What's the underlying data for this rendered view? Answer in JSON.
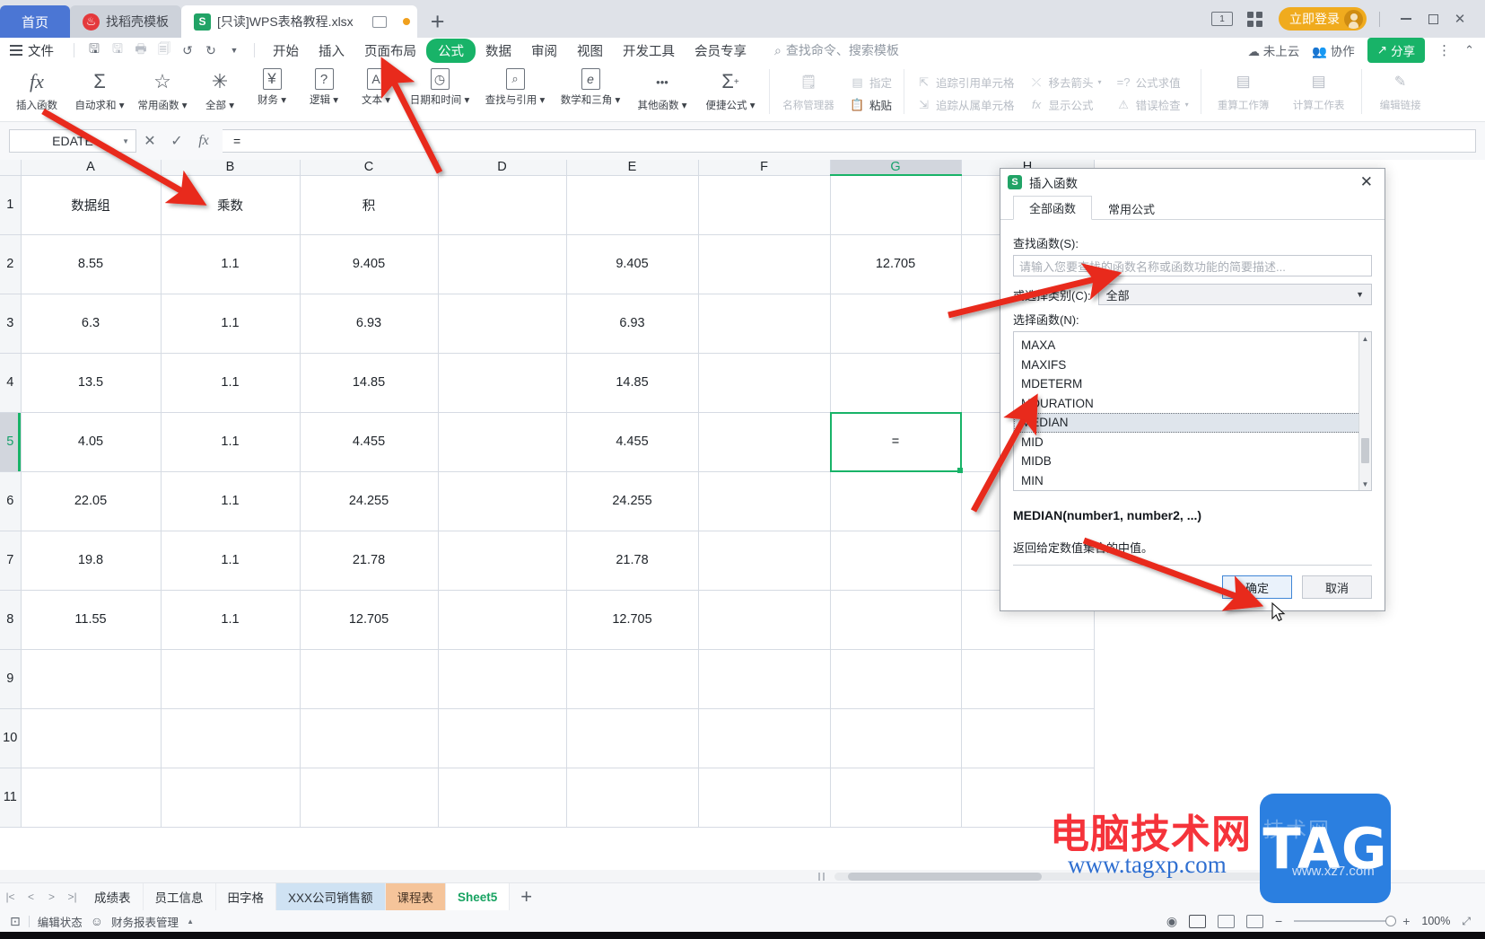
{
  "window": {
    "tabs": [
      {
        "label": "首页",
        "kind": "home"
      },
      {
        "label": "找稻壳模板",
        "kind": "template",
        "icon": "wps-dove-icon"
      },
      {
        "label": "[只读]WPS表格教程.xlsx",
        "kind": "doc",
        "icon": "spreadsheet-icon"
      }
    ],
    "new_tab": "+",
    "screens_badge": "1",
    "login_label": "立即登录",
    "minimize": "–",
    "maximize": "□",
    "close": "✕"
  },
  "menu": {
    "file_label": "文件",
    "quick_icons": [
      "save-icon",
      "save-as-icon",
      "print-icon",
      "print-preview-icon",
      "undo-icon",
      "redo-icon",
      "customize-icon"
    ],
    "items": [
      "开始",
      "插入",
      "页面布局",
      "公式",
      "数据",
      "审阅",
      "视图",
      "开发工具",
      "会员专享"
    ],
    "active_item": "公式",
    "search_placeholder": "查找命令、搜索模板",
    "cloud_status": "未上云",
    "collaborate": "协作",
    "share": "分享"
  },
  "ribbon": {
    "big_buttons": [
      {
        "label": "插入函数",
        "glyph": "fx",
        "caret": false
      },
      {
        "label": "自动求和",
        "glyph": "Σ",
        "caret": true
      },
      {
        "label": "常用函数",
        "glyph": "☆",
        "caret": true
      },
      {
        "label": "全部",
        "glyph": "✳",
        "caret": true
      },
      {
        "label": "财务",
        "glyph": "¥",
        "caret": true
      },
      {
        "label": "逻辑",
        "glyph": "?",
        "caret": true
      },
      {
        "label": "文本",
        "glyph": "A",
        "caret": true
      },
      {
        "label": "日期和时间",
        "glyph": "◷",
        "caret": true
      },
      {
        "label": "查找与引用",
        "glyph": "🔍",
        "caret": true
      },
      {
        "label": "数学和三角",
        "glyph": "e",
        "caret": true
      },
      {
        "label": "其他函数",
        "glyph": "···",
        "caret": true
      },
      {
        "label": "便捷公式",
        "glyph": "Σx",
        "caret": true
      }
    ],
    "name_manager": "名称管理器",
    "assign": "指定",
    "paste": "粘贴",
    "trace_precedents": "追踪引用单元格",
    "trace_dependents": "追踪从属单元格",
    "remove_arrows": "移去箭头",
    "show_formulas": "显示公式",
    "evaluate_formula": "公式求值",
    "error_check": "错误检查",
    "recalc_workbook": "重算工作簿",
    "calc_sheet": "计算工作表",
    "edit_links": "编辑链接"
  },
  "formula_bar": {
    "name_box": "EDATE",
    "cancel": "✕",
    "confirm": "✓",
    "fx": "fx",
    "value": "="
  },
  "grid": {
    "columns": [
      "A",
      "B",
      "C",
      "D",
      "E",
      "F",
      "G",
      "H"
    ],
    "selected_column": "G",
    "selected_row": "5",
    "selected_cell_value": "=",
    "rows": [
      {
        "n": "1",
        "cells": [
          "数据组",
          "乘数",
          "积",
          "",
          "",
          "",
          "",
          ""
        ],
        "header": true
      },
      {
        "n": "2",
        "cells": [
          "8.55",
          "1.1",
          "9.405",
          "",
          "9.405",
          "",
          "12.705",
          ""
        ]
      },
      {
        "n": "3",
        "cells": [
          "6.3",
          "1.1",
          "6.93",
          "",
          "6.93",
          "",
          "",
          ""
        ]
      },
      {
        "n": "4",
        "cells": [
          "13.5",
          "1.1",
          "14.85",
          "",
          "14.85",
          "",
          "",
          ""
        ]
      },
      {
        "n": "5",
        "cells": [
          "4.05",
          "1.1",
          "4.455",
          "",
          "4.455",
          "",
          "=",
          ""
        ]
      },
      {
        "n": "6",
        "cells": [
          "22.05",
          "1.1",
          "24.255",
          "",
          "24.255",
          "",
          "",
          ""
        ]
      },
      {
        "n": "7",
        "cells": [
          "19.8",
          "1.1",
          "21.78",
          "",
          "21.78",
          "",
          "",
          ""
        ]
      },
      {
        "n": "8",
        "cells": [
          "11.55",
          "1.1",
          "12.705",
          "",
          "12.705",
          "",
          "",
          ""
        ]
      },
      {
        "n": "9",
        "cells": [
          "",
          "",
          "",
          "",
          "",
          "",
          "",
          ""
        ]
      },
      {
        "n": "10",
        "cells": [
          "",
          "",
          "",
          "",
          "",
          "",
          "",
          ""
        ]
      },
      {
        "n": "11",
        "cells": [
          "",
          "",
          "",
          "",
          "",
          "",
          "",
          ""
        ]
      }
    ]
  },
  "dialog": {
    "title": "插入函数",
    "close": "✕",
    "tabs": [
      "全部函数",
      "常用公式"
    ],
    "active_tab": "全部函数",
    "search_label": "查找函数(S):",
    "search_placeholder": "请输入您要查找的函数名称或函数功能的简要描述...",
    "category_label": "或选择类别(C):",
    "category_value": "全部",
    "list_label": "选择函数(N):",
    "functions": [
      "MAXA",
      "MAXIFS",
      "MDETERM",
      "MDURATION",
      "MEDIAN",
      "MID",
      "MIDB",
      "MIN"
    ],
    "selected_function": "MEDIAN",
    "signature": "MEDIAN(number1, number2, ...)",
    "description": "返回给定数值集合的中值。",
    "ok": "确定",
    "cancel": "取消"
  },
  "sheet_bar": {
    "nav": [
      "|<",
      "<",
      ">",
      ">|"
    ],
    "sheets": [
      {
        "label": "成绩表",
        "style": "plain"
      },
      {
        "label": "员工信息",
        "style": "plain"
      },
      {
        "label": "田字格",
        "style": "plain"
      },
      {
        "label": "XXX公司销售额",
        "style": "blue"
      },
      {
        "label": "课程表",
        "style": "orange"
      },
      {
        "label": "Sheet5",
        "style": "active"
      }
    ],
    "add": "+"
  },
  "status_bar": {
    "edit_state": "编辑状态",
    "report_mgmt": "财务报表管理",
    "zoom": "100%",
    "view_icons": [
      "eye-icon",
      "normal-view-icon",
      "page-layout-icon",
      "page-break-icon"
    ]
  },
  "watermark": {
    "brand": "电脑技术网",
    "url": "www.tagxp.com",
    "logo": "TAG",
    "sub": "www.xz7.com"
  },
  "colors": {
    "accent_green": "#18b368",
    "tab_blue": "#4b76d4",
    "login_orange": "#f0ab1e",
    "arrow_red": "#e8291f"
  }
}
